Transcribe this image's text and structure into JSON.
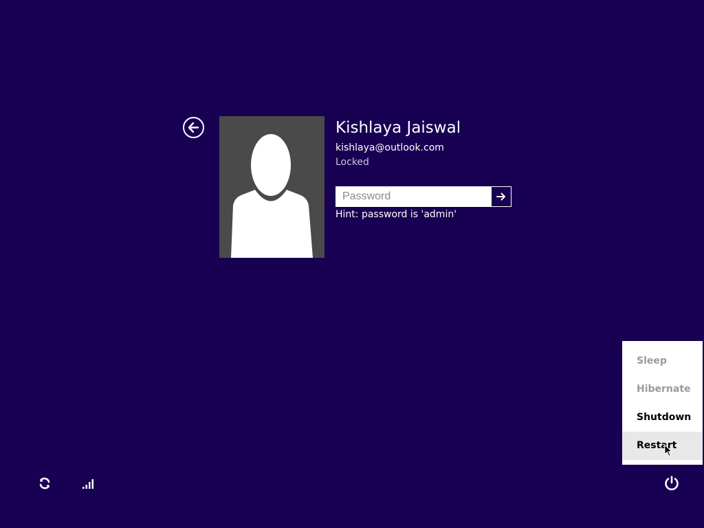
{
  "user": {
    "name": "Kishlaya Jaiswal",
    "email": "kishlaya@outlook.com",
    "status": "Locked"
  },
  "login": {
    "password_placeholder": "Password",
    "password_value": "",
    "hint": "Hint: password is 'admin'"
  },
  "power_menu": {
    "items": [
      {
        "label": "Sleep",
        "enabled": false
      },
      {
        "label": "Hibernate",
        "enabled": false
      },
      {
        "label": "Shutdown",
        "enabled": true
      },
      {
        "label": "Restart",
        "enabled": true,
        "highlighted": true
      }
    ]
  },
  "icons": {
    "back": "back-arrow-icon",
    "submit": "arrow-right-icon",
    "ease_of_access": "ease-of-access-icon",
    "network": "network-signal-icon",
    "power": "power-icon"
  },
  "colors": {
    "background": "#180052",
    "avatar_bg": "#4a4a4a",
    "menu_bg": "#ffffff",
    "menu_disabled": "#9a9a9a",
    "menu_hover": "#e8e8e8"
  }
}
